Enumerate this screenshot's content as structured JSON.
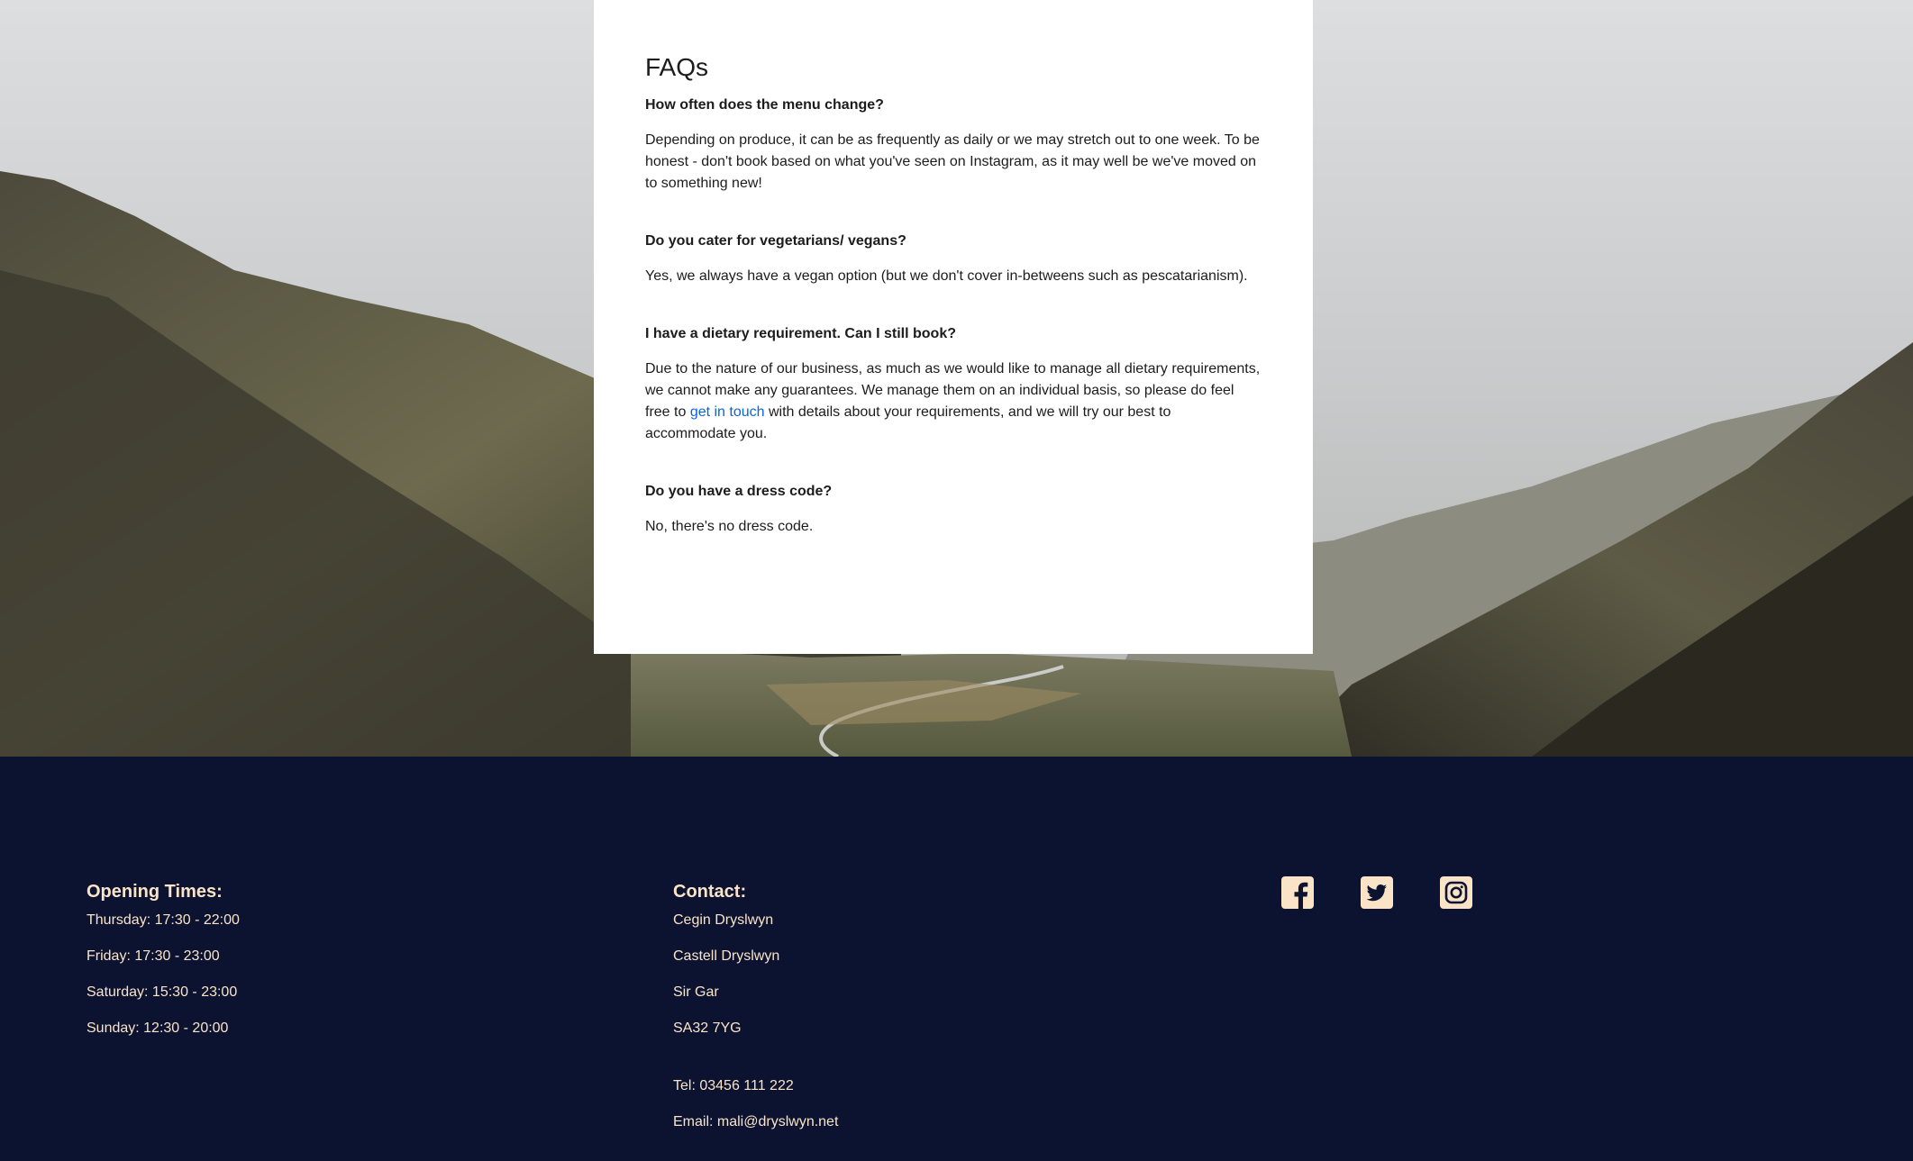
{
  "faq": {
    "title": "FAQs",
    "items": [
      {
        "question": "How often does the menu change?",
        "answer": "Depending on produce, it can be as frequently as daily or we may stretch out to one week. To be honest - don't book based on what you've seen on Instagram, as it may well be we've moved on to something new!"
      },
      {
        "question": "Do you cater for vegetarians/ vegans?",
        "answer": "Yes, we always have a vegan option (but we don't cover in-betweens such as pescatarianism)."
      },
      {
        "question": "I have a dietary requirement. Can I still book?",
        "answer_before": "Due to the nature of our business, as much as we would like to manage all dietary requirements, we cannot make any guarantees. We manage them on an individual basis, so please do feel free to ",
        "link_text": "get in touch",
        "answer_after": " with details about your requirements, and we will try our best to accommodate you."
      },
      {
        "question": "Do you have a dress code?",
        "answer": "No, there's no dress code."
      }
    ]
  },
  "footer": {
    "opening": {
      "title": "Opening Times:",
      "lines": [
        "Thursday: 17:30 - 22:00",
        "Friday: 17:30 - 23:00",
        "Saturday: 15:30 - 23:00",
        "Sunday: 12:30 - 20:00"
      ]
    },
    "contact": {
      "title": "Contact:",
      "address": [
        "Cegin Dryslwyn",
        "Castell Dryslwyn",
        "Sir Gar",
        "SA32 7YG"
      ],
      "tel": "Tel: 03456 111 222",
      "email": "Email: mali@dryslwyn.net"
    },
    "social": {
      "icons": [
        "facebook-icon",
        "twitter-icon",
        "instagram-icon"
      ],
      "color": "#fbe3c8"
    }
  },
  "colors": {
    "footer_bg": "#0b1330",
    "footer_text": "#fbe3c8",
    "link": "#0a66d8"
  }
}
